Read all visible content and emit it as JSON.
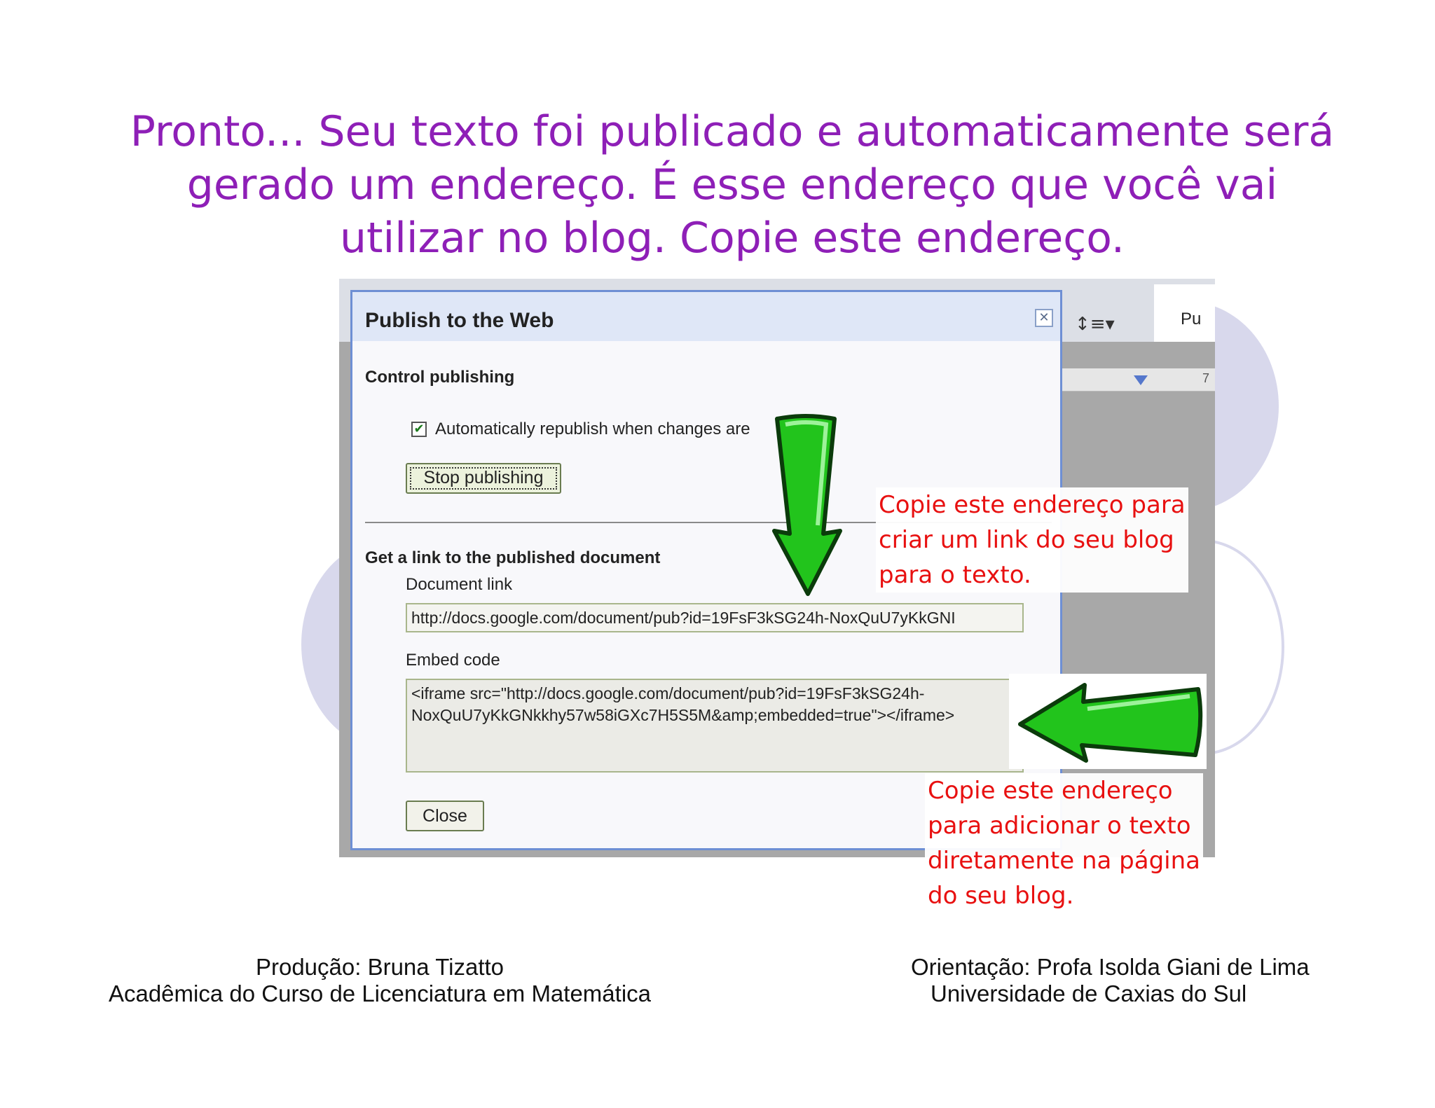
{
  "slide": {
    "title_lines": [
      "Pronto... Seu texto foi publicado e automaticamente será",
      "gerado um endereço. É esse endereço que você vai",
      "utilizar no blog. Copie este endereço."
    ]
  },
  "background_app": {
    "tab_label": "Pu",
    "ruler_number": "7",
    "format_icon": "line-spacing-icon"
  },
  "dialog": {
    "title": "Publish to the Web",
    "close_icon": "close-icon",
    "control_heading": "Control publishing",
    "checkbox_label": "Automatically republish when changes are",
    "checkbox_checked": true,
    "stop_button": "Stop publishing",
    "link_heading": "Get a link to the published document",
    "document_link_label": "Document link",
    "document_link_value": "http://docs.google.com/document/pub?id=19FsF3kSG24h-NoxQuU7yKkGNI",
    "embed_label": "Embed code",
    "embed_value_line1": "<iframe src=\"http://docs.google.com/document/pub?id=19FsF3kSG24h-",
    "embed_value_line2": "NoxQuU7yKkGNkkhy57w58iGXc7H5S5M&amp;embedded=true\"></iframe>",
    "close_button": "Close"
  },
  "annotations": {
    "callout_link": [
      "Copie este endereço para",
      "criar um link do seu blog",
      "para o texto."
    ],
    "callout_embed": [
      "Copie este endereço",
      "para adicionar o texto",
      "diretamente na página",
      "do seu blog."
    ],
    "arrow_color": "#22c41c"
  },
  "footer": {
    "left_line1": "Produção: Bruna Tizatto",
    "left_line2": "Acadêmica do Curso de Licenciatura em Matemática",
    "right_line1": "Orientação: Profa Isolda Giani de Lima",
    "right_line2": "Universidade de Caxias do Sul"
  },
  "colors": {
    "title": "#8e1fb7",
    "callout": "#e81010",
    "dialog_border": "#6e8fd4"
  }
}
